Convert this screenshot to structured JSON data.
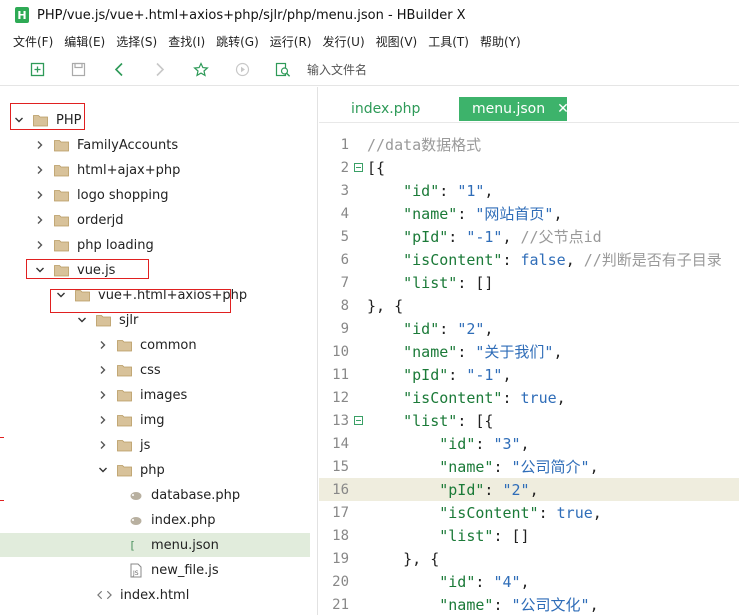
{
  "window": {
    "app_icon": "H",
    "title": "PHP/vue.js/vue+.html+axios+php/sjlr/php/menu.json - HBuilder X"
  },
  "menu": [
    "文件(F)",
    "编辑(E)",
    "选择(S)",
    "查找(I)",
    "跳转(G)",
    "运行(R)",
    "发行(U)",
    "视图(V)",
    "工具(T)",
    "帮助(Y)"
  ],
  "toolbar": {
    "icons": [
      "new-file-icon",
      "save-icon",
      "back-arrow-icon",
      "forward-arrow-icon",
      "star-icon",
      "run-icon",
      "find-file-icon"
    ],
    "input_placeholder": "输入文件名"
  },
  "colors": {
    "accent": "#3db36b",
    "selected_row": "#e1ecdc",
    "highlight_line": "#efedde",
    "annotation_red": "#e02020",
    "folder": "#c7a878"
  },
  "tree": [
    {
      "label": "PHP",
      "depth": 0,
      "expanded": true,
      "type": "folder"
    },
    {
      "label": "FamilyAccounts",
      "depth": 1,
      "expanded": false,
      "type": "folder"
    },
    {
      "label": "html+ajax+php",
      "depth": 1,
      "expanded": false,
      "type": "folder"
    },
    {
      "label": "logo shopping",
      "depth": 1,
      "expanded": false,
      "type": "folder"
    },
    {
      "label": "orderjd",
      "depth": 1,
      "expanded": false,
      "type": "folder"
    },
    {
      "label": "php loading",
      "depth": 1,
      "expanded": false,
      "type": "folder"
    },
    {
      "label": "vue.js",
      "depth": 1,
      "expanded": true,
      "type": "folder"
    },
    {
      "label": "vue+.html+axios+php",
      "depth": 2,
      "expanded": true,
      "type": "folder"
    },
    {
      "label": "sjlr",
      "depth": 3,
      "expanded": true,
      "type": "folder"
    },
    {
      "label": "common",
      "depth": 4,
      "expanded": false,
      "type": "folder"
    },
    {
      "label": "css",
      "depth": 4,
      "expanded": false,
      "type": "folder"
    },
    {
      "label": "images",
      "depth": 4,
      "expanded": false,
      "type": "folder"
    },
    {
      "label": "img",
      "depth": 4,
      "expanded": false,
      "type": "folder"
    },
    {
      "label": "js",
      "depth": 4,
      "expanded": false,
      "type": "folder"
    },
    {
      "label": "php",
      "depth": 4,
      "expanded": true,
      "type": "folder"
    },
    {
      "label": "database.php",
      "depth": 5,
      "type": "php"
    },
    {
      "label": "index.php",
      "depth": 5,
      "type": "php"
    },
    {
      "label": "menu.json",
      "depth": 5,
      "type": "json",
      "selected": true
    },
    {
      "label": "new_file.js",
      "depth": 5,
      "type": "js"
    },
    {
      "label": "index.html",
      "depth": 4,
      "type": "html"
    }
  ],
  "tabs": [
    {
      "label": "index.php",
      "active": false
    },
    {
      "label": "menu.json",
      "active": true,
      "close": "✕"
    }
  ],
  "code_lines": [
    {
      "n": "1",
      "fold": false,
      "hl": false,
      "tokens": [
        [
          "c",
          "//data数据格式"
        ]
      ]
    },
    {
      "n": "2",
      "fold": true,
      "hl": false,
      "tokens": [
        [
          "p",
          "[{"
        ]
      ]
    },
    {
      "n": "3",
      "fold": false,
      "hl": false,
      "tokens": [
        [
          "p",
          "    "
        ],
        [
          "k",
          "\"id\""
        ],
        [
          "p",
          ": "
        ],
        [
          "s",
          "\"1\""
        ],
        [
          "p",
          ","
        ]
      ]
    },
    {
      "n": "4",
      "fold": false,
      "hl": false,
      "tokens": [
        [
          "p",
          "    "
        ],
        [
          "k",
          "\"name\""
        ],
        [
          "p",
          ": "
        ],
        [
          "s",
          "\"网站首页\""
        ],
        [
          "p",
          ","
        ]
      ]
    },
    {
      "n": "5",
      "fold": false,
      "hl": false,
      "tokens": [
        [
          "p",
          "    "
        ],
        [
          "k",
          "\"pId\""
        ],
        [
          "p",
          ": "
        ],
        [
          "s",
          "\"-1\""
        ],
        [
          "p",
          ", "
        ],
        [
          "c",
          "//父节点id"
        ]
      ]
    },
    {
      "n": "6",
      "fold": false,
      "hl": false,
      "tokens": [
        [
          "p",
          "    "
        ],
        [
          "k",
          "\"isContent\""
        ],
        [
          "p",
          ": "
        ],
        [
          "b",
          "false"
        ],
        [
          "p",
          ", "
        ],
        [
          "c",
          "//判断是否有子目录"
        ]
      ]
    },
    {
      "n": "7",
      "fold": false,
      "hl": false,
      "tokens": [
        [
          "p",
          "    "
        ],
        [
          "k",
          "\"list\""
        ],
        [
          "p",
          ": []"
        ]
      ]
    },
    {
      "n": "8",
      "fold": false,
      "hl": false,
      "tokens": [
        [
          "p",
          "}, {"
        ]
      ]
    },
    {
      "n": "9",
      "fold": false,
      "hl": false,
      "tokens": [
        [
          "p",
          "    "
        ],
        [
          "k",
          "\"id\""
        ],
        [
          "p",
          ": "
        ],
        [
          "s",
          "\"2\""
        ],
        [
          "p",
          ","
        ]
      ]
    },
    {
      "n": "10",
      "fold": false,
      "hl": false,
      "tokens": [
        [
          "p",
          "    "
        ],
        [
          "k",
          "\"name\""
        ],
        [
          "p",
          ": "
        ],
        [
          "s",
          "\"关于我们\""
        ],
        [
          "p",
          ","
        ]
      ]
    },
    {
      "n": "11",
      "fold": false,
      "hl": false,
      "tokens": [
        [
          "p",
          "    "
        ],
        [
          "k",
          "\"pId\""
        ],
        [
          "p",
          ": "
        ],
        [
          "s",
          "\"-1\""
        ],
        [
          "p",
          ","
        ]
      ]
    },
    {
      "n": "12",
      "fold": false,
      "hl": false,
      "tokens": [
        [
          "p",
          "    "
        ],
        [
          "k",
          "\"isContent\""
        ],
        [
          "p",
          ": "
        ],
        [
          "b",
          "true"
        ],
        [
          "p",
          ","
        ]
      ]
    },
    {
      "n": "13",
      "fold": true,
      "hl": false,
      "tokens": [
        [
          "p",
          "    "
        ],
        [
          "k",
          "\"list\""
        ],
        [
          "p",
          ": [{"
        ]
      ]
    },
    {
      "n": "14",
      "fold": false,
      "hl": false,
      "tokens": [
        [
          "p",
          "        "
        ],
        [
          "k",
          "\"id\""
        ],
        [
          "p",
          ": "
        ],
        [
          "s",
          "\"3\""
        ],
        [
          "p",
          ","
        ]
      ]
    },
    {
      "n": "15",
      "fold": false,
      "hl": false,
      "tokens": [
        [
          "p",
          "        "
        ],
        [
          "k",
          "\"name\""
        ],
        [
          "p",
          ": "
        ],
        [
          "s",
          "\"公司简介\""
        ],
        [
          "p",
          ","
        ]
      ]
    },
    {
      "n": "16",
      "fold": false,
      "hl": true,
      "tokens": [
        [
          "p",
          "        "
        ],
        [
          "k",
          "\"pId\""
        ],
        [
          "p",
          ": "
        ],
        [
          "s",
          "\"2\""
        ],
        [
          "p",
          ","
        ]
      ]
    },
    {
      "n": "17",
      "fold": false,
      "hl": false,
      "tokens": [
        [
          "p",
          "        "
        ],
        [
          "k",
          "\"isContent\""
        ],
        [
          "p",
          ": "
        ],
        [
          "b",
          "true"
        ],
        [
          "p",
          ","
        ]
      ]
    },
    {
      "n": "18",
      "fold": false,
      "hl": false,
      "tokens": [
        [
          "p",
          "        "
        ],
        [
          "k",
          "\"list\""
        ],
        [
          "p",
          ": []"
        ]
      ]
    },
    {
      "n": "19",
      "fold": false,
      "hl": false,
      "tokens": [
        [
          "p",
          "    }, {"
        ]
      ]
    },
    {
      "n": "20",
      "fold": false,
      "hl": false,
      "tokens": [
        [
          "p",
          "        "
        ],
        [
          "k",
          "\"id\""
        ],
        [
          "p",
          ": "
        ],
        [
          "s",
          "\"4\""
        ],
        [
          "p",
          ","
        ]
      ]
    },
    {
      "n": "21",
      "fold": false,
      "hl": false,
      "tokens": [
        [
          "p",
          "        "
        ],
        [
          "k",
          "\"name\""
        ],
        [
          "p",
          ": "
        ],
        [
          "s",
          "\"公司文化\""
        ],
        [
          "p",
          ","
        ]
      ]
    }
  ]
}
